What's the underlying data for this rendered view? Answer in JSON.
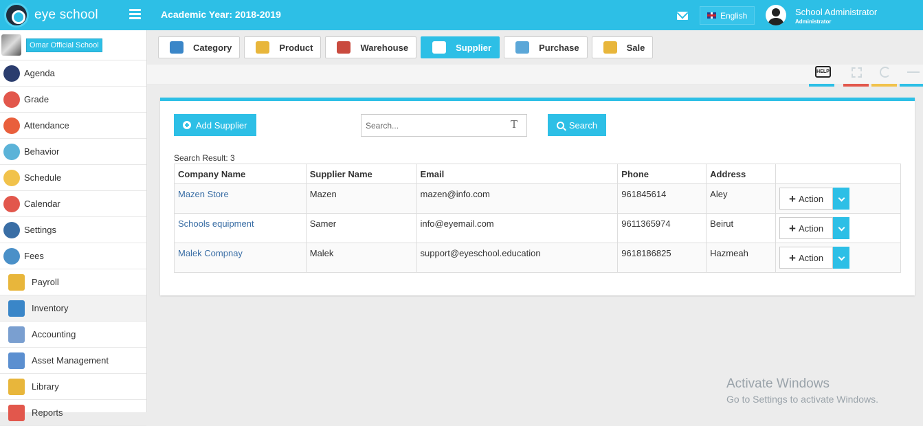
{
  "app": {
    "logo_text": "eye school",
    "academic_year": "Academic Year: 2018-2019"
  },
  "header": {
    "language": "English",
    "user_name": "School Administrator",
    "user_role": "Administrator"
  },
  "sidebar": {
    "school_name": "Omar Official School",
    "items": [
      {
        "label": "Agenda",
        "icon": "agenda-icon",
        "color": "#2b3d6e"
      },
      {
        "label": "Grade",
        "icon": "grade-icon",
        "color": "#e2574c"
      },
      {
        "label": "Attendance",
        "icon": "attendance-icon",
        "color": "#e95f3c"
      },
      {
        "label": "Behavior",
        "icon": "behavior-icon",
        "color": "#5bb3d8"
      },
      {
        "label": "Schedule",
        "icon": "schedule-icon",
        "color": "#f1c24b"
      },
      {
        "label": "Calendar",
        "icon": "calendar-icon",
        "color": "#e2574c"
      },
      {
        "label": "Settings",
        "icon": "settings-icon",
        "color": "#3a6ea5"
      },
      {
        "label": "Fees",
        "icon": "fees-icon",
        "color": "#4a90c8"
      },
      {
        "label": "Payroll",
        "icon": "payroll-icon",
        "color": "#e8b63b"
      },
      {
        "label": "Inventory",
        "icon": "inventory-icon",
        "color": "#3a86c8"
      },
      {
        "label": "Accounting",
        "icon": "accounting-icon",
        "color": "#7a9fd0"
      },
      {
        "label": "Asset Management",
        "icon": "asset-management-icon",
        "color": "#5b8fd0"
      },
      {
        "label": "Library",
        "icon": "library-icon",
        "color": "#e8b63b"
      },
      {
        "label": "Reports",
        "icon": "reports-icon",
        "color": "#e2574c"
      }
    ]
  },
  "tabs": [
    {
      "label": "Category",
      "icon": "category-icon",
      "color": "#3a86c8"
    },
    {
      "label": "Product",
      "icon": "product-icon",
      "color": "#e8b63b"
    },
    {
      "label": "Warehouse",
      "icon": "warehouse-icon",
      "color": "#c94a3e"
    },
    {
      "label": "Supplier",
      "icon": "supplier-icon",
      "color": "#f0a07a"
    },
    {
      "label": "Purchase",
      "icon": "purchase-icon",
      "color": "#5ba7d8"
    },
    {
      "label": "Sale",
      "icon": "sale-icon",
      "color": "#e8b63b"
    }
  ],
  "toolbar": {
    "help_label": "HELP",
    "underline_colors": [
      "#2dbfe6",
      "#e2574c",
      "#f1c24b",
      "#2dbfe6"
    ]
  },
  "supplier_panel": {
    "add_label": "Add Supplier",
    "search_placeholder": "Search...",
    "search_label": "Search",
    "result_text": "Search Result: 3",
    "columns": [
      "Company Name",
      "Supplier Name",
      "Email",
      "Phone",
      "Address",
      ""
    ],
    "rows": [
      {
        "company": "Mazen Store",
        "supplier": "Mazen",
        "email": "mazen@info.com",
        "phone": "961845614",
        "address": "Aley",
        "action": "Action"
      },
      {
        "company": "Schools equipment",
        "supplier": "Samer",
        "email": "info@eyemail.com",
        "phone": "9611365974",
        "address": "Beirut",
        "action": "Action"
      },
      {
        "company": "Malek Compnay",
        "supplier": "Malek",
        "email": "support@eyeschool.education",
        "phone": "9618186825",
        "address": "Hazmeah",
        "action": "Action"
      }
    ]
  },
  "watermark": {
    "line1": "Activate Windows",
    "line2": "Go to Settings to activate Windows."
  }
}
